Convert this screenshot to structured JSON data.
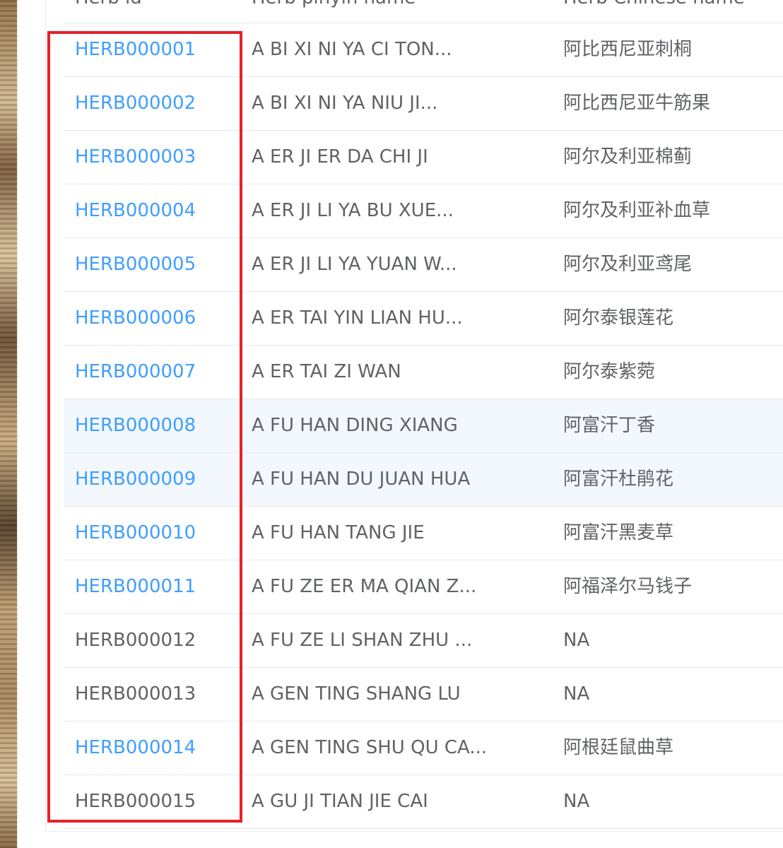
{
  "table": {
    "headers": {
      "id": "Herb id",
      "pinyin": "Herb pinyin name",
      "chinese": "Herb Chinese name"
    },
    "rows": [
      {
        "id": "HERB000001",
        "pinyin": "A BI XI NI YA CI TON...",
        "chinese": "阿比西尼亚刺桐",
        "link": true
      },
      {
        "id": "HERB000002",
        "pinyin": "A BI XI NI YA NIU JI...",
        "chinese": "阿比西尼亚牛筋果",
        "link": true
      },
      {
        "id": "HERB000003",
        "pinyin": "A ER JI ER DA CHI JI",
        "chinese": "阿尔及利亚棉蓟",
        "link": true
      },
      {
        "id": "HERB000004",
        "pinyin": "A ER JI LI YA BU XUE...",
        "chinese": "阿尔及利亚补血草",
        "link": true
      },
      {
        "id": "HERB000005",
        "pinyin": "A ER JI LI YA YUAN W...",
        "chinese": "阿尔及利亚鸢尾",
        "link": true
      },
      {
        "id": "HERB000006",
        "pinyin": "A ER TAI YIN LIAN HU...",
        "chinese": "阿尔泰银莲花",
        "link": true
      },
      {
        "id": "HERB000007",
        "pinyin": "A ER TAI ZI WAN",
        "chinese": "阿尔泰紫菀",
        "link": true
      },
      {
        "id": "HERB000008",
        "pinyin": "A FU HAN DING XIANG",
        "chinese": "阿富汗丁香",
        "link": true
      },
      {
        "id": "HERB000009",
        "pinyin": "A FU HAN DU JUAN HUA",
        "chinese": "阿富汗杜鹃花",
        "link": true
      },
      {
        "id": "HERB000010",
        "pinyin": "A FU HAN TANG JIE",
        "chinese": "阿富汗黑麦草",
        "link": true
      },
      {
        "id": "HERB000011",
        "pinyin": "A FU ZE ER MA QIAN Z...",
        "chinese": "阿福泽尔马钱子",
        "link": true
      },
      {
        "id": "HERB000012",
        "pinyin": "A FU ZE LI SHAN ZHU ...",
        "chinese": "NA",
        "link": false
      },
      {
        "id": "HERB000013",
        "pinyin": "A GEN TING SHANG LU",
        "chinese": "NA",
        "link": false
      },
      {
        "id": "HERB000014",
        "pinyin": "A GEN TING SHU QU CA...",
        "chinese": "阿根廷鼠曲草",
        "link": true
      },
      {
        "id": "HERB000015",
        "pinyin": "A GU JI TIAN JIE CAI",
        "chinese": "NA",
        "link": false
      }
    ]
  },
  "colors": {
    "link": "#409eff",
    "text": "#606266",
    "highlight_border": "#e8202b",
    "hover_row": "#f2f8fe"
  }
}
